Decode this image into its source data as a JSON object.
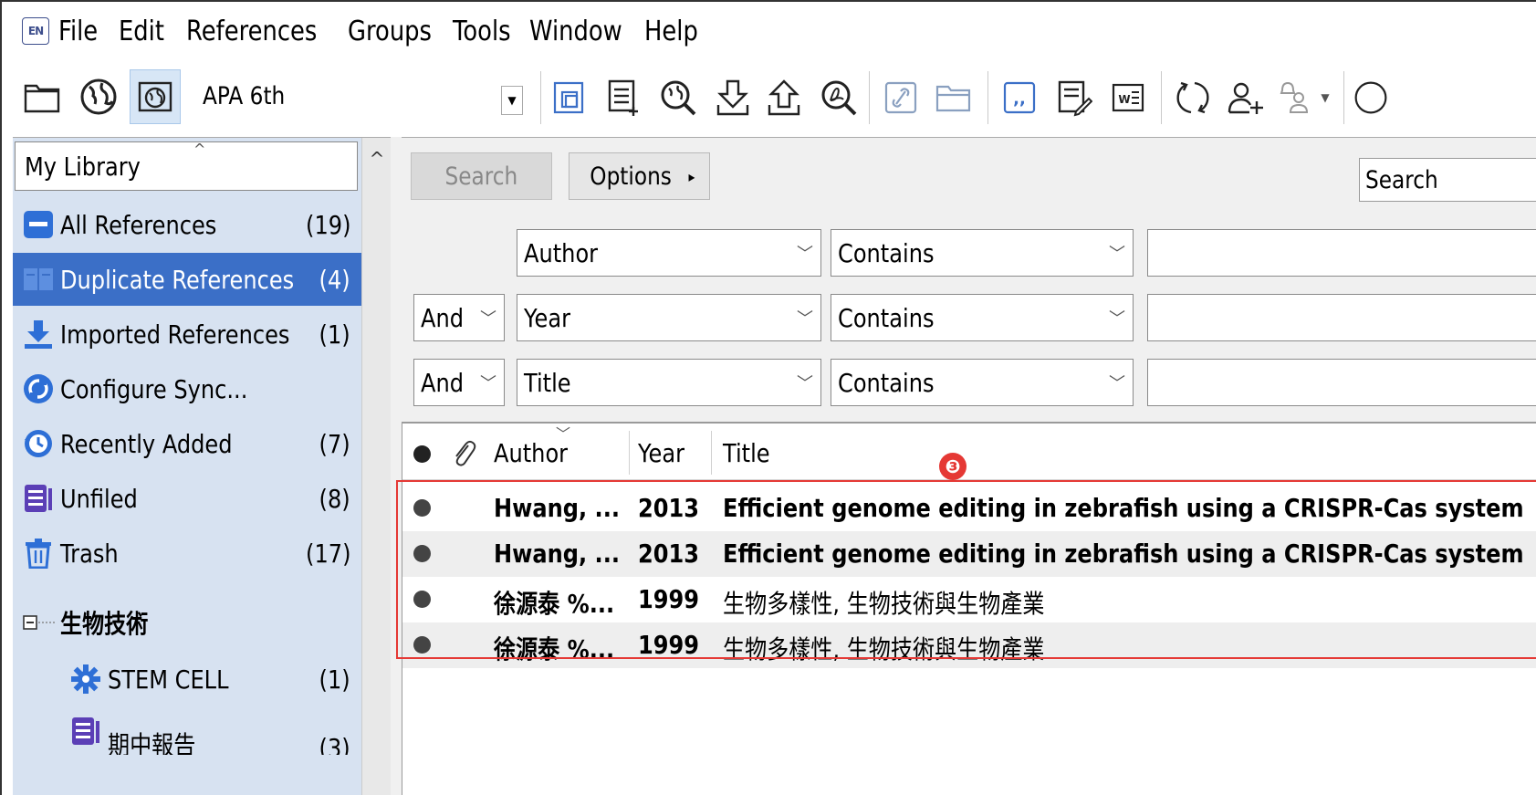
{
  "app": {
    "logo_text": "EN"
  },
  "menu": [
    "File",
    "Edit",
    "References",
    "Groups",
    "Tools",
    "Window",
    "Help"
  ],
  "toolbar": {
    "style": "APA 6th",
    "icons": [
      "local-library-icon",
      "online-search-icon",
      "integrated-library-icon",
      "copy-to-library-icon",
      "new-reference-icon",
      "online-search-magnifier-icon",
      "import-icon",
      "export-icon",
      "find-full-text-icon",
      "open-link-icon",
      "open-file-icon",
      "insert-citation-icon",
      "format-bibliography-icon",
      "return-to-word-icon",
      "sync-icon",
      "share-group-icon",
      "share-notify-icon",
      "help-icon"
    ]
  },
  "library": {
    "selector_label": "My Library",
    "groups": [
      {
        "label": "All References",
        "count": "(19)",
        "icon": "all-references-icon"
      },
      {
        "label": "Duplicate References",
        "count": "(4)",
        "icon": "duplicate-references-icon"
      },
      {
        "label": "Imported References",
        "count": "(1)",
        "icon": "imported-references-icon"
      },
      {
        "label": "Configure Sync...",
        "count": "",
        "icon": "configure-sync-icon"
      },
      {
        "label": "Recently Added",
        "count": "(7)",
        "icon": "recently-added-icon"
      },
      {
        "label": "Unfiled",
        "count": "(8)",
        "icon": "unfiled-icon"
      },
      {
        "label": "Trash",
        "count": "(17)",
        "icon": "trash-icon"
      },
      {
        "label": "生物技術",
        "count": "",
        "icon": "group-set-collapse-icon"
      },
      {
        "label": "STEM CELL",
        "count": "(1)",
        "icon": "smart-group-icon"
      },
      {
        "label": "期中報告",
        "count": "(3)",
        "icon": "group-icon"
      }
    ]
  },
  "search": {
    "search_button": "Search",
    "options_button": "Options",
    "options_arrow": "▸",
    "right_field": "Search",
    "rows": [
      {
        "bool": "",
        "field": "Author",
        "op": "Contains"
      },
      {
        "bool": "And",
        "field": "Year",
        "op": "Contains"
      },
      {
        "bool": "And",
        "field": "Title",
        "op": "Contains"
      }
    ]
  },
  "references": {
    "columns": {
      "author": "Author",
      "year": "Year",
      "title": "Title"
    },
    "rows": [
      {
        "author": "Hwang, ...",
        "year": "2013",
        "title": "Efficient genome editing in zebrafish using a CRISPR-Cas system"
      },
      {
        "author": "Hwang, ...",
        "year": "2013",
        "title": "Efficient genome editing in zebrafish using a CRISPR-Cas system"
      },
      {
        "author": "徐源泰 %...",
        "year": "1999",
        "title": "生物多樣性, 生物技術與生物產業"
      },
      {
        "author": "徐源泰 %...",
        "year": "1999",
        "title": "生物多樣性, 生物技術與生物產業"
      }
    ]
  },
  "annotation": {
    "marker": "❸",
    "color": "#e53935"
  },
  "colors": {
    "selected": "#3b6fc7",
    "sidebar": "#d7e2f1",
    "accent": "#3d4e8c"
  }
}
